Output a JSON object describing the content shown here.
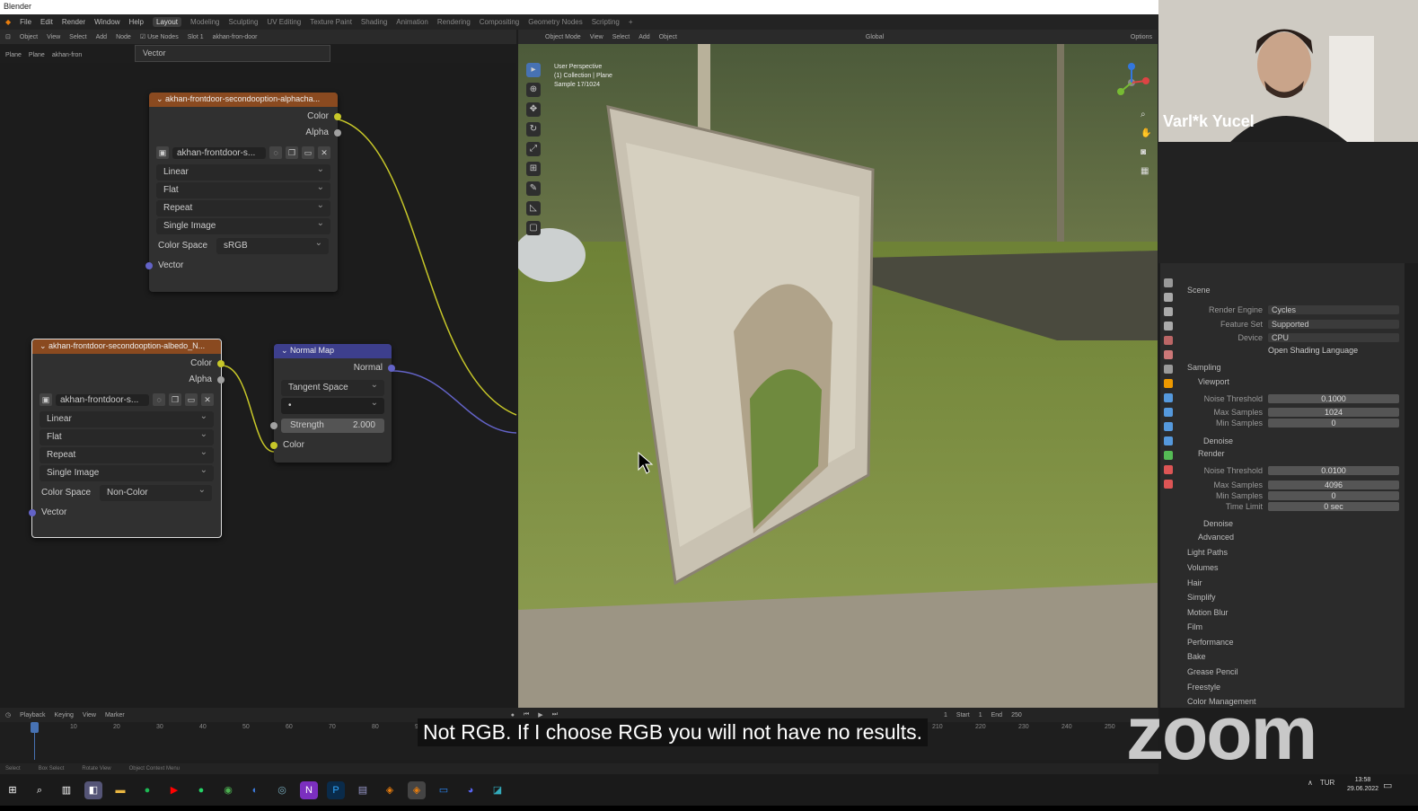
{
  "app": {
    "title": "Blender"
  },
  "menubar": {
    "menus": [
      "File",
      "Edit",
      "Render",
      "Window",
      "Help"
    ],
    "workspaces": [
      "Layout",
      "Modeling",
      "Sculpting",
      "UV Editing",
      "Texture Paint",
      "Shading",
      "Animation",
      "Rendering",
      "Compositing",
      "Geometry Nodes",
      "Scripting",
      "+"
    ]
  },
  "node_header": {
    "object_label": "Object",
    "items": [
      "View",
      "Select",
      "Add",
      "Node"
    ],
    "use_nodes": "Use Nodes",
    "slot": "Slot 1",
    "material": "akhan-fron-door"
  },
  "breadcrumb": [
    "Plane",
    "Plane",
    "akhan-fron"
  ],
  "vector_popup": "Vector",
  "node_alpha": {
    "title": "akhan-frontdoor-secondooption-alphacha...",
    "outputs": [
      "Color",
      "Alpha"
    ],
    "image_name": "akhan-frontdoor-s...",
    "interpolation": "Linear",
    "projection": "Flat",
    "extension": "Repeat",
    "source": "Single Image",
    "colorspace_label": "Color Space",
    "colorspace_value": "sRGB",
    "input": "Vector"
  },
  "node_albedo": {
    "title": "akhan-frontdoor-secondooption-albedo_N...",
    "outputs": [
      "Color",
      "Alpha"
    ],
    "image_name": "akhan-frontdoor-s...",
    "interpolation": "Linear",
    "projection": "Flat",
    "extension": "Repeat",
    "source": "Single Image",
    "colorspace_label": "Color Space",
    "colorspace_value": "Non-Color",
    "input": "Vector"
  },
  "node_normal": {
    "title": "Normal Map",
    "output": "Normal",
    "space": "Tangent Space",
    "uv_placeholder": "•",
    "strength_label": "Strength",
    "strength_value": "2.000",
    "input": "Color"
  },
  "viewport_header": {
    "mode": "Object Mode",
    "items": [
      "View",
      "Select",
      "Add",
      "Object"
    ],
    "orientation": "Global",
    "options": "Options"
  },
  "viewport_info": {
    "line1": "User Perspective",
    "line2": "(1) Collection | Plane",
    "line3": "Sample 17/1024"
  },
  "camera": {
    "name": "Varl*k Yucel"
  },
  "properties": {
    "scene": "Scene",
    "render_engine_label": "Render Engine",
    "render_engine": "Cycles",
    "feature_set_label": "Feature Set",
    "feature_set": "Supported",
    "device_label": "Device",
    "device": "CPU",
    "osl": "Open Shading Language",
    "sampling": "Sampling",
    "viewport": "Viewport",
    "noise_threshold_label": "Noise Threshold",
    "vp_noise_threshold": "0.1000",
    "max_samples_label": "Max Samples",
    "vp_max_samples": "1024",
    "min_samples_label": "Min Samples",
    "vp_min_samples": "0",
    "denoise": "Denoise",
    "render": "Render",
    "r_noise_threshold": "0.0100",
    "r_max_samples": "4096",
    "r_min_samples": "0",
    "time_limit_label": "Time Limit",
    "r_time_limit": "0 sec",
    "advanced": "Advanced",
    "sections": [
      "Light Paths",
      "Volumes",
      "Hair",
      "Simplify",
      "Motion Blur",
      "Film",
      "Performance",
      "Bake",
      "Grease Pencil",
      "Freestyle",
      "Color Management"
    ]
  },
  "timeline": {
    "menus": [
      "Playback",
      "Keying",
      "View",
      "Marker"
    ],
    "current_frame": "1",
    "start_label": "Start",
    "start": "1",
    "end_label": "End",
    "end": "250",
    "ticks": [
      "10",
      "20",
      "30",
      "40",
      "50",
      "60",
      "70",
      "80",
      "90",
      "100",
      "110",
      "120",
      "130",
      "140",
      "150",
      "160",
      "170",
      "180",
      "190",
      "200",
      "210",
      "220",
      "230",
      "240",
      "250"
    ]
  },
  "statusbar": [
    "Select",
    "Box Select",
    "Rotate View",
    "Object Context Menu"
  ],
  "caption": "Not RGB. If I choose RGB you will not have no results.",
  "zoom_logo": "zoom",
  "taskbar": {
    "lang": "TUR",
    "time": "13:58",
    "date": "29.06.2022"
  },
  "colors": {
    "texture_header": "#8a4a20",
    "vector_header": "#3d3f8d",
    "socket_color": "#c7c729",
    "socket_vector": "#6363c7",
    "accent": "#4772b3"
  }
}
